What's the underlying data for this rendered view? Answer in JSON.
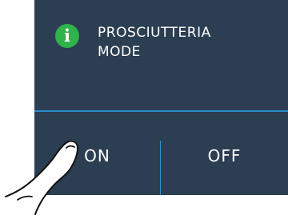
{
  "notification": {
    "icon": "info-icon",
    "icon_glyph": "i",
    "title_line1": "PROSCIUTTERIA",
    "title_line2": "MODE"
  },
  "buttons": {
    "on_label": "ON",
    "off_label": "OFF"
  },
  "colors": {
    "panel_background": "#2c3e52",
    "accent_divider": "#2a8fd0",
    "icon_green": "#2fb34a",
    "text": "#ffffff"
  }
}
